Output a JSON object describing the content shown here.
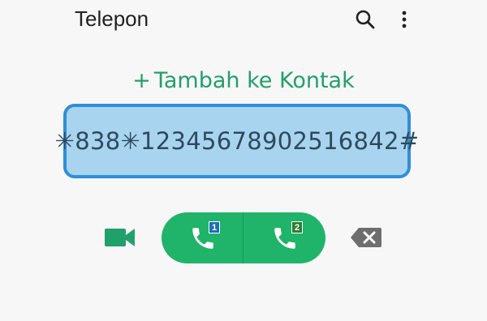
{
  "app_bar": {
    "title": "Telepon",
    "search_icon": "search-icon",
    "more_icon": "more-vert-icon"
  },
  "add_contact": {
    "plus": "+",
    "label": "Tambah ke Kontak"
  },
  "dialer": {
    "number": "✳838✳12345678902516842#"
  },
  "call_buttons": {
    "sim1_label": "1",
    "sim2_label": "2",
    "video_icon": "video-camera-icon",
    "call_icon": "phone-icon",
    "backspace_icon": "backspace-icon"
  },
  "colors": {
    "accent_green": "#22a06a",
    "call_green": "#1fb46a",
    "field_bg": "#a9d4f0",
    "field_border": "#2f8fd6",
    "sim1": "#1e6fb5",
    "sim2": "#2e7d32"
  }
}
